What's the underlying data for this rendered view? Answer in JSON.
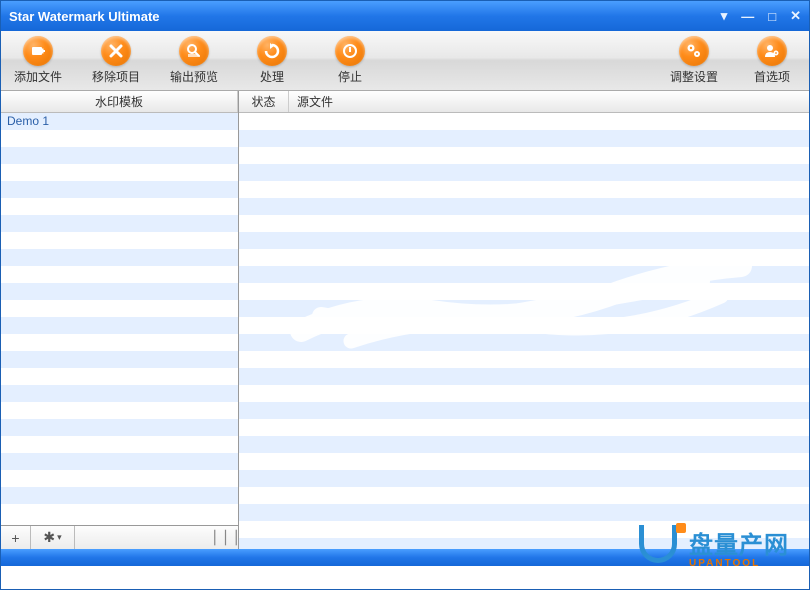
{
  "window": {
    "title": "Star Watermark Ultimate"
  },
  "toolbar": {
    "add_files": "添加文件",
    "remove_items": "移除项目",
    "output_preview": "输出预览",
    "process": "处理",
    "stop": "停止",
    "adjust_settings": "调整设置",
    "preferences": "首选项"
  },
  "columns": {
    "template": "水印模板",
    "status": "状态",
    "source": "源文件"
  },
  "templates": {
    "items": [
      {
        "name": "Demo 1"
      }
    ]
  },
  "bottom": {
    "add": "+",
    "gear": "✱",
    "dropdown": "▾",
    "drag": "⎪⎪⎪"
  },
  "logo": {
    "cn": "盘量产网",
    "en": "UPANTOOL"
  }
}
